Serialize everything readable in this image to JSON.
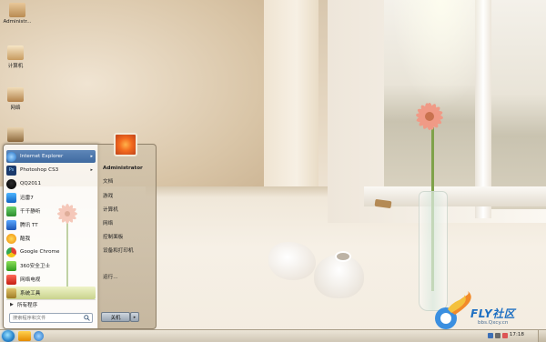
{
  "desktop": {
    "icons": [
      {
        "label": "Administr...",
        "icon": "user-folder-icon"
      },
      {
        "label": "计算机",
        "icon": "computer-icon"
      },
      {
        "label": "网络",
        "icon": "network-icon"
      },
      {
        "label": "",
        "icon": "recycle-bin-icon"
      }
    ]
  },
  "start_menu": {
    "programs": [
      {
        "label": "Internet Explorer",
        "icon": "internet-explorer-icon",
        "has_submenu": true,
        "selected": true
      },
      {
        "label": "Photoshop CS3",
        "icon": "photoshop-icon",
        "has_submenu": true,
        "selected": false
      },
      {
        "label": "QQ2011",
        "icon": "qq-icon",
        "has_submenu": false,
        "selected": false
      },
      {
        "label": "迅雷7",
        "icon": "thunder-icon",
        "has_submenu": false,
        "selected": false
      },
      {
        "label": "千千静听",
        "icon": "ttplayer-icon",
        "has_submenu": false,
        "selected": false
      },
      {
        "label": "腾讯 TT",
        "icon": "tt-browser-icon",
        "has_submenu": false,
        "selected": false
      },
      {
        "label": "酷我",
        "icon": "kuwo-icon",
        "has_submenu": false,
        "selected": false
      },
      {
        "label": "Google Chrome",
        "icon": "chrome-icon",
        "has_submenu": false,
        "selected": false
      },
      {
        "label": "360安全卫士",
        "icon": "360-safe-icon",
        "has_submenu": false,
        "selected": false
      },
      {
        "label": "网络电视",
        "icon": "pptv-icon",
        "has_submenu": false,
        "selected": false
      },
      {
        "label": "系统工具",
        "icon": "system-tools-icon",
        "has_submenu": true,
        "highlighted": true
      }
    ],
    "all_programs": "所有程序",
    "search_placeholder": "搜索程序和文件",
    "right_items": [
      "Administrator",
      "文档",
      "游戏",
      "计算机",
      "网络",
      "控制面板",
      "设备和打印机",
      "运行..."
    ],
    "shutdown_label": "关机"
  },
  "taskbar": {
    "clock": "17:18"
  },
  "watermark": {
    "brand": "FLY社区",
    "url": "bbs.Qxcy.cn"
  },
  "colors": {
    "selection_blue": "#4a77ad",
    "highlight_green": "#c9d38d",
    "brand_blue": "#1e6fc2"
  }
}
